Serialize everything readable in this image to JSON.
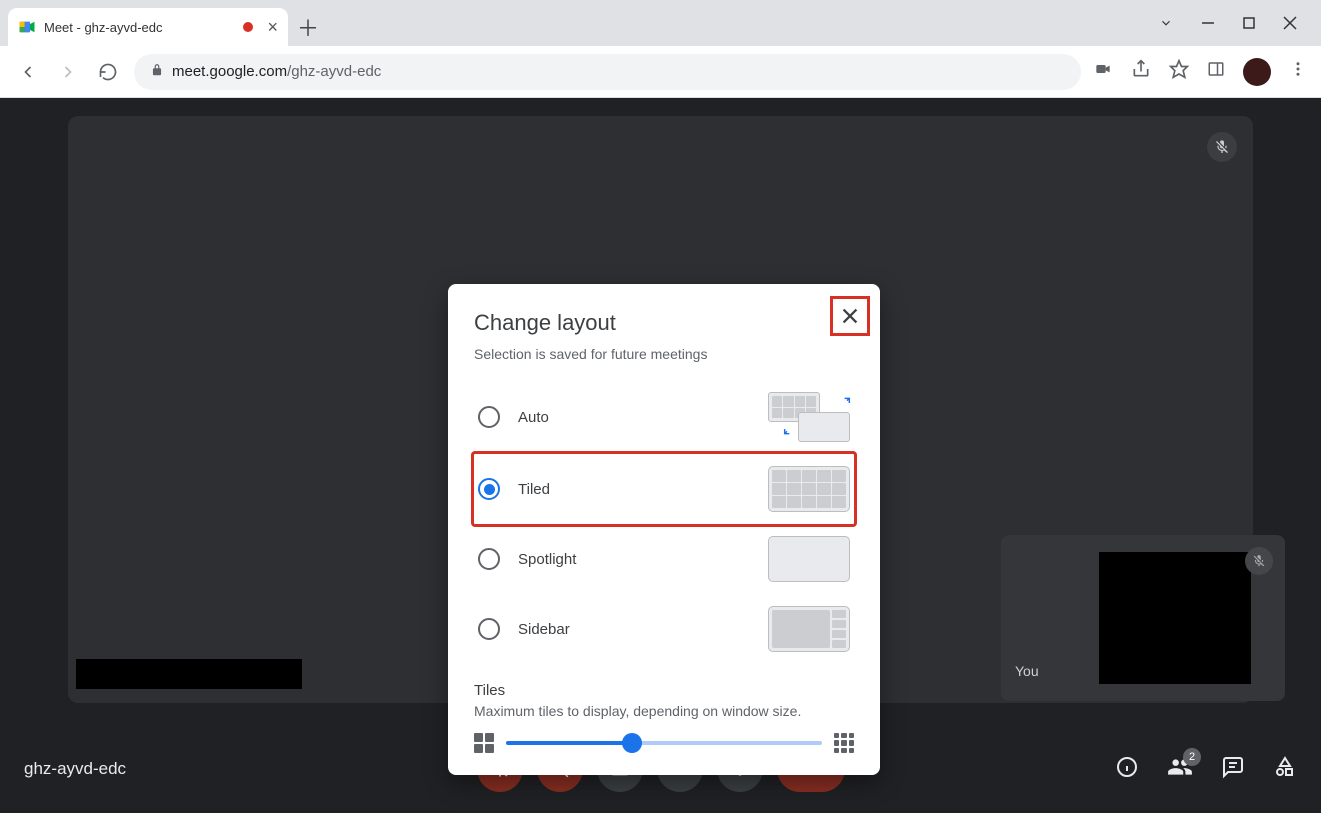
{
  "browser": {
    "tab_title": "Meet - ghz-ayvd-edc",
    "url_host": "meet.google.com",
    "url_path": "/ghz-ayvd-edc"
  },
  "meet": {
    "code": "ghz-ayvd-edc",
    "self_label": "You",
    "participants_count": "2"
  },
  "dialog": {
    "title": "Change layout",
    "subtitle": "Selection is saved for future meetings",
    "options": [
      {
        "key": "auto",
        "label": "Auto",
        "selected": false
      },
      {
        "key": "tiled",
        "label": "Tiled",
        "selected": true
      },
      {
        "key": "spotlight",
        "label": "Spotlight",
        "selected": false
      },
      {
        "key": "sidebar",
        "label": "Sidebar",
        "selected": false
      }
    ],
    "tiles_section_title": "Tiles",
    "tiles_section_sub": "Maximum tiles to display, depending on window size.",
    "slider_percent": 40
  },
  "highlights": {
    "close_button": true,
    "tiled_row": true
  }
}
